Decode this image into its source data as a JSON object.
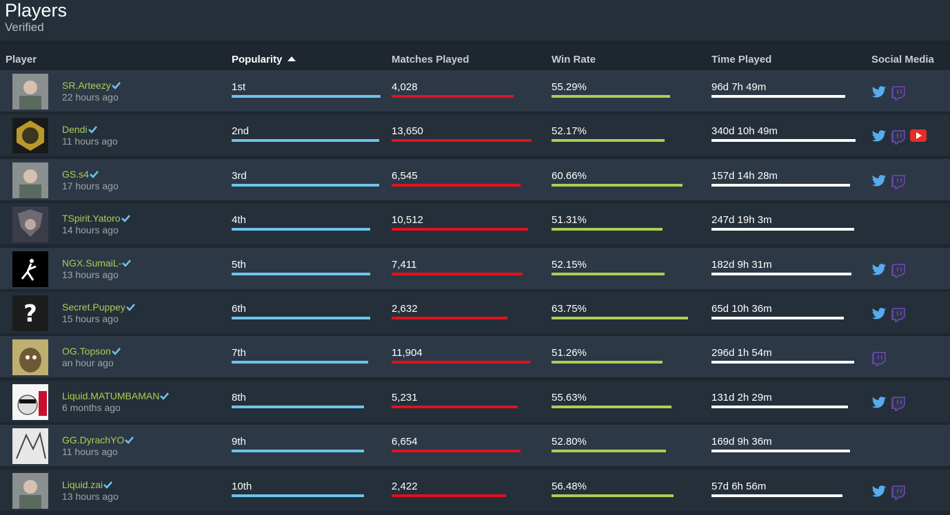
{
  "header": {
    "title": "Players",
    "subtitle": "Verified"
  },
  "columns": {
    "player": "Player",
    "popularity": "Popularity",
    "matches": "Matches Played",
    "winrate": "Win Rate",
    "time": "Time Played",
    "social": "Social Media"
  },
  "colors": {
    "name": "#a9cf54",
    "popularity_bar": "#6cc4ec",
    "matches_bar": "#e5101d",
    "winrate_bar": "#a9cf54",
    "time_bar": "#ffffff",
    "twitter": "#55acee",
    "twitch": "#6441a5",
    "youtube": "#e52d27"
  },
  "players": [
    {
      "name": "SR.Arteezy",
      "last": "22 hours ago",
      "rank": "1st",
      "rank_fill": 0.99,
      "matches": "4,028",
      "matches_fill": 0.81,
      "winrate": "55.29%",
      "winrate_fill": 0.79,
      "time": "96d 7h 49m",
      "time_fill": 0.89,
      "social": [
        "twitter",
        "twitch"
      ],
      "avatar": "photo-icon"
    },
    {
      "name": "Dendi",
      "last": "11 hours ago",
      "rank": "2nd",
      "rank_fill": 0.98,
      "matches": "13,650",
      "matches_fill": 0.93,
      "winrate": "52.17%",
      "winrate_fill": 0.75,
      "time": "340d 10h 49m",
      "time_fill": 0.96,
      "social": [
        "twitter",
        "twitch",
        "youtube"
      ],
      "avatar": "mask-icon"
    },
    {
      "name": "GS.s4",
      "last": "17 hours ago",
      "rank": "3rd",
      "rank_fill": 0.98,
      "matches": "6,545",
      "matches_fill": 0.86,
      "winrate": "60.66%",
      "winrate_fill": 0.87,
      "time": "157d 14h 28m",
      "time_fill": 0.92,
      "social": [
        "twitter",
        "twitch"
      ],
      "avatar": "photo-icon"
    },
    {
      "name": "TSpirit.Yatoro",
      "last": "14 hours ago",
      "rank": "4th",
      "rank_fill": 0.92,
      "matches": "10,512",
      "matches_fill": 0.91,
      "winrate": "51.31%",
      "winrate_fill": 0.74,
      "time": "247d 19h 3m",
      "time_fill": 0.95,
      "social": [],
      "avatar": "anime-icon"
    },
    {
      "name": "NGX.SumaiL-",
      "last": "13 hours ago",
      "rank": "5th",
      "rank_fill": 0.92,
      "matches": "7,411",
      "matches_fill": 0.87,
      "winrate": "52.15%",
      "winrate_fill": 0.75,
      "time": "182d 9h 31m",
      "time_fill": 0.93,
      "social": [
        "twitter",
        "twitch"
      ],
      "avatar": "jumpman-icon"
    },
    {
      "name": "Secret.Puppey",
      "last": "15 hours ago",
      "rank": "6th",
      "rank_fill": 0.92,
      "matches": "2,632",
      "matches_fill": 0.77,
      "winrate": "63.75%",
      "winrate_fill": 0.91,
      "time": "65d 10h 36m",
      "time_fill": 0.88,
      "social": [
        "twitter",
        "twitch"
      ],
      "avatar": "question-icon"
    },
    {
      "name": "OG.Topson",
      "last": "an hour ago",
      "rank": "7th",
      "rank_fill": 0.91,
      "matches": "11,904",
      "matches_fill": 0.92,
      "winrate": "51.26%",
      "winrate_fill": 0.74,
      "time": "296d 1h 54m",
      "time_fill": 0.95,
      "social": [
        "twitch"
      ],
      "avatar": "creature-icon"
    },
    {
      "name": "Liquid.MATUMBAMAN",
      "last": "6 months ago",
      "rank": "8th",
      "rank_fill": 0.88,
      "matches": "5,231",
      "matches_fill": 0.84,
      "winrate": "55.63%",
      "winrate_fill": 0.8,
      "time": "131d 2h 29m",
      "time_fill": 0.91,
      "social": [
        "twitter",
        "twitch"
      ],
      "avatar": "meme-icon"
    },
    {
      "name": "GG.DyrachYO",
      "last": "11 hours ago",
      "rank": "9th",
      "rank_fill": 0.88,
      "matches": "6,654",
      "matches_fill": 0.86,
      "winrate": "52.80%",
      "winrate_fill": 0.76,
      "time": "169d 9h 36m",
      "time_fill": 0.92,
      "social": [],
      "avatar": "sketch-icon"
    },
    {
      "name": "Liquid.zai",
      "last": "13 hours ago",
      "rank": "10th",
      "rank_fill": 0.88,
      "matches": "2,422",
      "matches_fill": 0.76,
      "winrate": "56.48%",
      "winrate_fill": 0.81,
      "time": "57d 6h 56m",
      "time_fill": 0.87,
      "social": [
        "twitter",
        "twitch"
      ],
      "avatar": "photo-icon"
    }
  ]
}
